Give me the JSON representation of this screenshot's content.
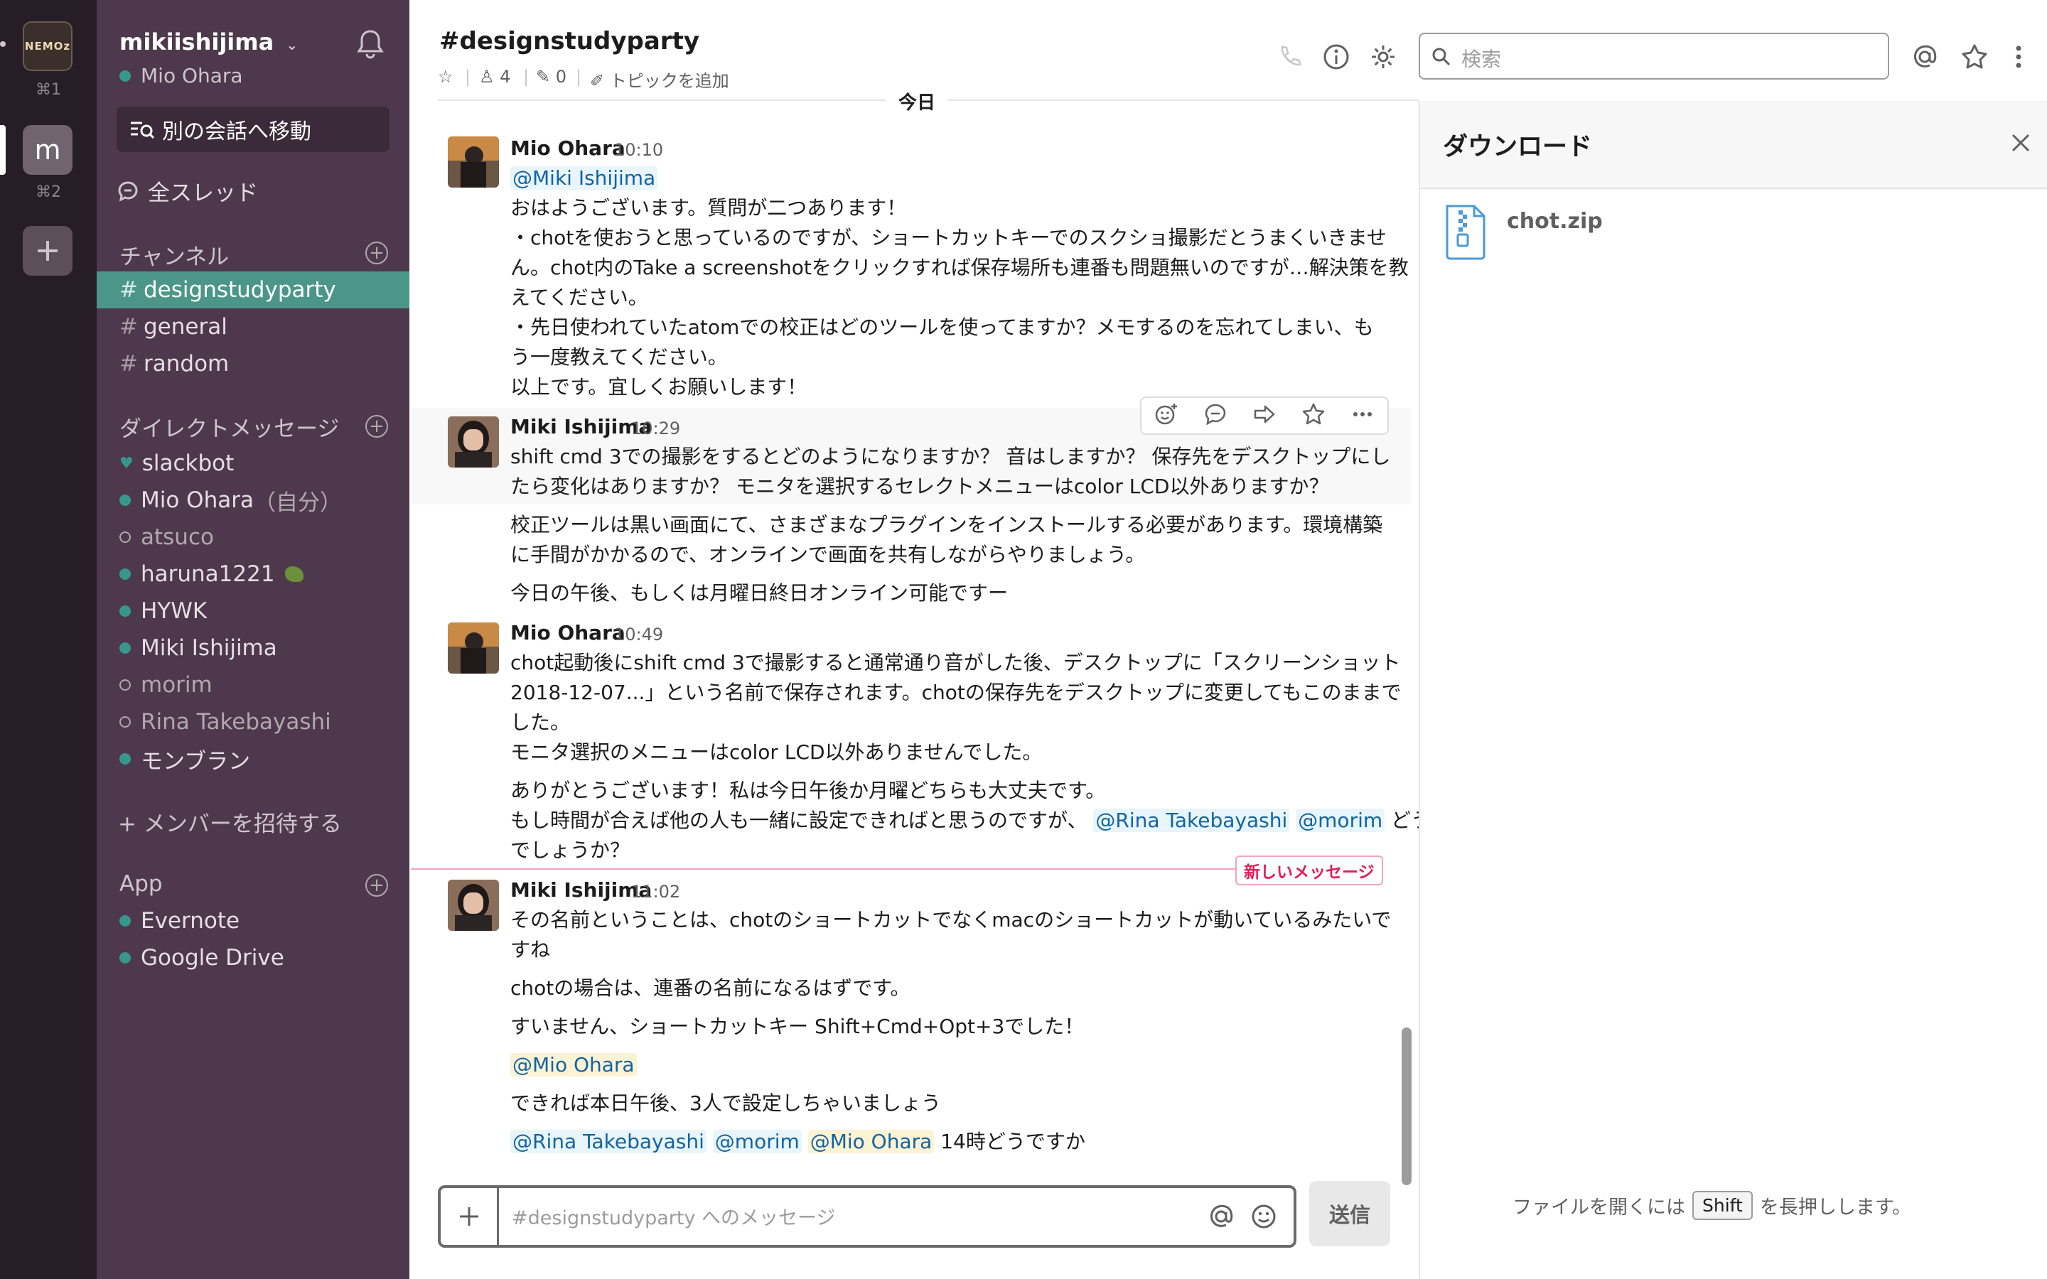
{
  "workspaces": [
    {
      "label": "NEMOz",
      "shortcut": "⌘1"
    },
    {
      "label": "m",
      "shortcut": "⌘2"
    }
  ],
  "sidebar": {
    "team_name": "mikiishijima",
    "user_name": "Mio Ohara",
    "jump_label": "別の会話へ移動",
    "threads_label": "全スレッド",
    "channels_heading": "チャンネル",
    "channels": [
      "designstudyparty",
      "general",
      "random"
    ],
    "dm_heading": "ダイレクトメッセージ",
    "dms": [
      {
        "name": "slackbot",
        "status": "bot"
      },
      {
        "name": "Mio Ohara",
        "suffix": "（自分）",
        "status": "online"
      },
      {
        "name": "atsuco",
        "status": "away"
      },
      {
        "name": "haruna1221",
        "status": "online"
      },
      {
        "name": "HYWK",
        "status": "online"
      },
      {
        "name": "Miki Ishijima",
        "status": "online"
      },
      {
        "name": "morim",
        "status": "away"
      },
      {
        "name": "Rina Takebayashi",
        "status": "away"
      },
      {
        "name": "モンブラン",
        "status": "online"
      }
    ],
    "invite_label": "+ メンバーを招待する",
    "apps_heading": "App",
    "apps": [
      "Evernote",
      "Google Drive"
    ]
  },
  "header": {
    "channel": "#designstudyparty",
    "members_count": "4",
    "pins_count": "0",
    "topic_label": "トピックを追加",
    "search_placeholder": "検索"
  },
  "messages": {
    "day_divider": "今日",
    "new_messages_label": "新しいメッセージ",
    "m1": {
      "author": "Mio Ohara",
      "time": "10:10",
      "mention": "@Miki Ishijima",
      "lines": [
        "おはようございます。質問が二つあります！",
        "・chotを使おうと思っているのですが、ショートカットキーでのスクショ撮影だとうまくいきませ",
        "ん。chot内のTake a screenshotをクリックすれば保存場所も連番も問題無いのですが…解決策を教",
        "えてください。",
        "・先日使われていたatomでの校正はどのツールを使ってますか？メモするのを忘れてしまい、も",
        "う一度教えてください。",
        "以上です。宜しくお願いします！"
      ]
    },
    "m2": {
      "author": "Miki Ishijima",
      "time": "10:29",
      "lines": [
        "shift cmd 3での撮影をするとどのようになりますか？ 音はしますか？ 保存先をデスクトップにし",
        "たら変化はありますか？ モニタを選択するセレクトメニューはcolor LCD以外ありますか？"
      ],
      "follow1": [
        "校正ツールは黒い画面にて、さまざまなプラグインをインストールする必要があります。環境構築",
        "に手間がかかるので、オンラインで画面を共有しながらやりましょう。"
      ],
      "follow2": "今日の午後、もしくは月曜日終日オンライン可能ですー"
    },
    "m3": {
      "author": "Mio Ohara",
      "time": "10:49",
      "lines": [
        "chot起動後にshift cmd 3で撮影すると通常通り音がした後、デスクトップに「スクリーンショット",
        "2018-12-07...」という名前で保存されます。chotの保存先をデスクトップに変更してもこのままで",
        "した。",
        "モニタ選択のメニューはcolor LCD以外ありませんでした。"
      ],
      "follow1": "ありがとうございます！私は今日午後か月曜どちらも大丈夫です。",
      "follow2_prefix": "もし時間が合えば他の人も一緒に設定できればと思うのですが、",
      "follow2_mention1": "@Rina Takebayashi",
      "follow2_mention2": "@morim",
      "follow2_suffix": "どう",
      "follow3": "でしょうか？"
    },
    "m4": {
      "author": "Miki Ishijima",
      "time": "11:02",
      "lines": [
        "その名前ということは、chotのショートカットでなくmacのショートカットが動いているみたいで",
        "すね"
      ],
      "follow1": "chotの場合は、連番の名前になるはずです。",
      "follow2": "すいません、ショートカットキー Shift+Cmd+Opt+3でした！",
      "mention_me": "@Mio Ohara",
      "follow3": "できれば本日午後、3人で設定しちゃいましょう",
      "last_mention1": "@Rina Takebayashi",
      "last_mention2": "@morim",
      "last_mention3": "@Mio Ohara",
      "last_suffix": "14時どうですか"
    }
  },
  "composer": {
    "placeholder": "#designstudyparty へのメッセージ",
    "send_label": "送信"
  },
  "right_panel": {
    "title": "ダウンロード",
    "file_name": "chot.zip",
    "hint_prefix": "ファイルを開くには",
    "hint_key": "Shift",
    "hint_suffix": "を長押しします。"
  },
  "colors": {
    "sidebar_bg": "#4d394b",
    "workspace_bg": "#261d26",
    "active_channel": "#4c9689",
    "presence_online": "#38978d",
    "mention_text": "#1264a3",
    "new_message_red": "#e01e5a"
  }
}
